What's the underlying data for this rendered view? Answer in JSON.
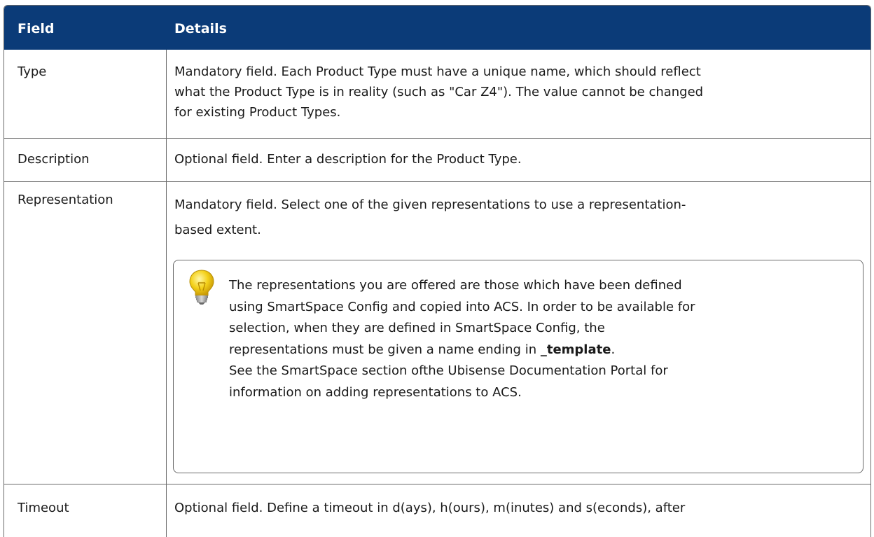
{
  "table": {
    "headers": {
      "field": "Field",
      "details": "Details"
    },
    "rows": [
      {
        "field": "Type",
        "details": [
          "Mandatory field. Each Product Type must have a unique name, which should reflect",
          "what the Product Type is in reality (such as \"Car Z4\"). The value cannot be changed",
          "for existing Product Types."
        ]
      },
      {
        "field": "Description",
        "details": [
          "Optional field. Enter a description for the Product Type."
        ]
      },
      {
        "field": "Representation",
        "details": [
          "Mandatory field. Select one of the given representations to use a representation-",
          "based extent."
        ],
        "note": {
          "icon": "lightbulb-icon",
          "lines": [
            "The representations you are offered are those which have been defined",
            "using SmartSpace Config and copied into ACS. In order to be available for",
            "selection, when they are defined in SmartSpace Config, the"
          ],
          "line4_prefix": "representations must be given a name ending in ",
          "line4_bold": "_template",
          "line4_suffix": ".",
          "lines_after": [
            "See the SmartSpace section ofthe Ubisense Documentation Portal for",
            "information on adding representations to ACS."
          ]
        }
      },
      {
        "field": "Timeout",
        "details": [
          "Optional field. Define a timeout in d(ays), h(ours), m(inutes) and s(econds), after"
        ]
      }
    ]
  },
  "colors": {
    "header_bg": "#0b3b78",
    "header_text": "#ffffff",
    "border": "#6b6b6b",
    "bulb_yellow": "#f4d11a"
  }
}
